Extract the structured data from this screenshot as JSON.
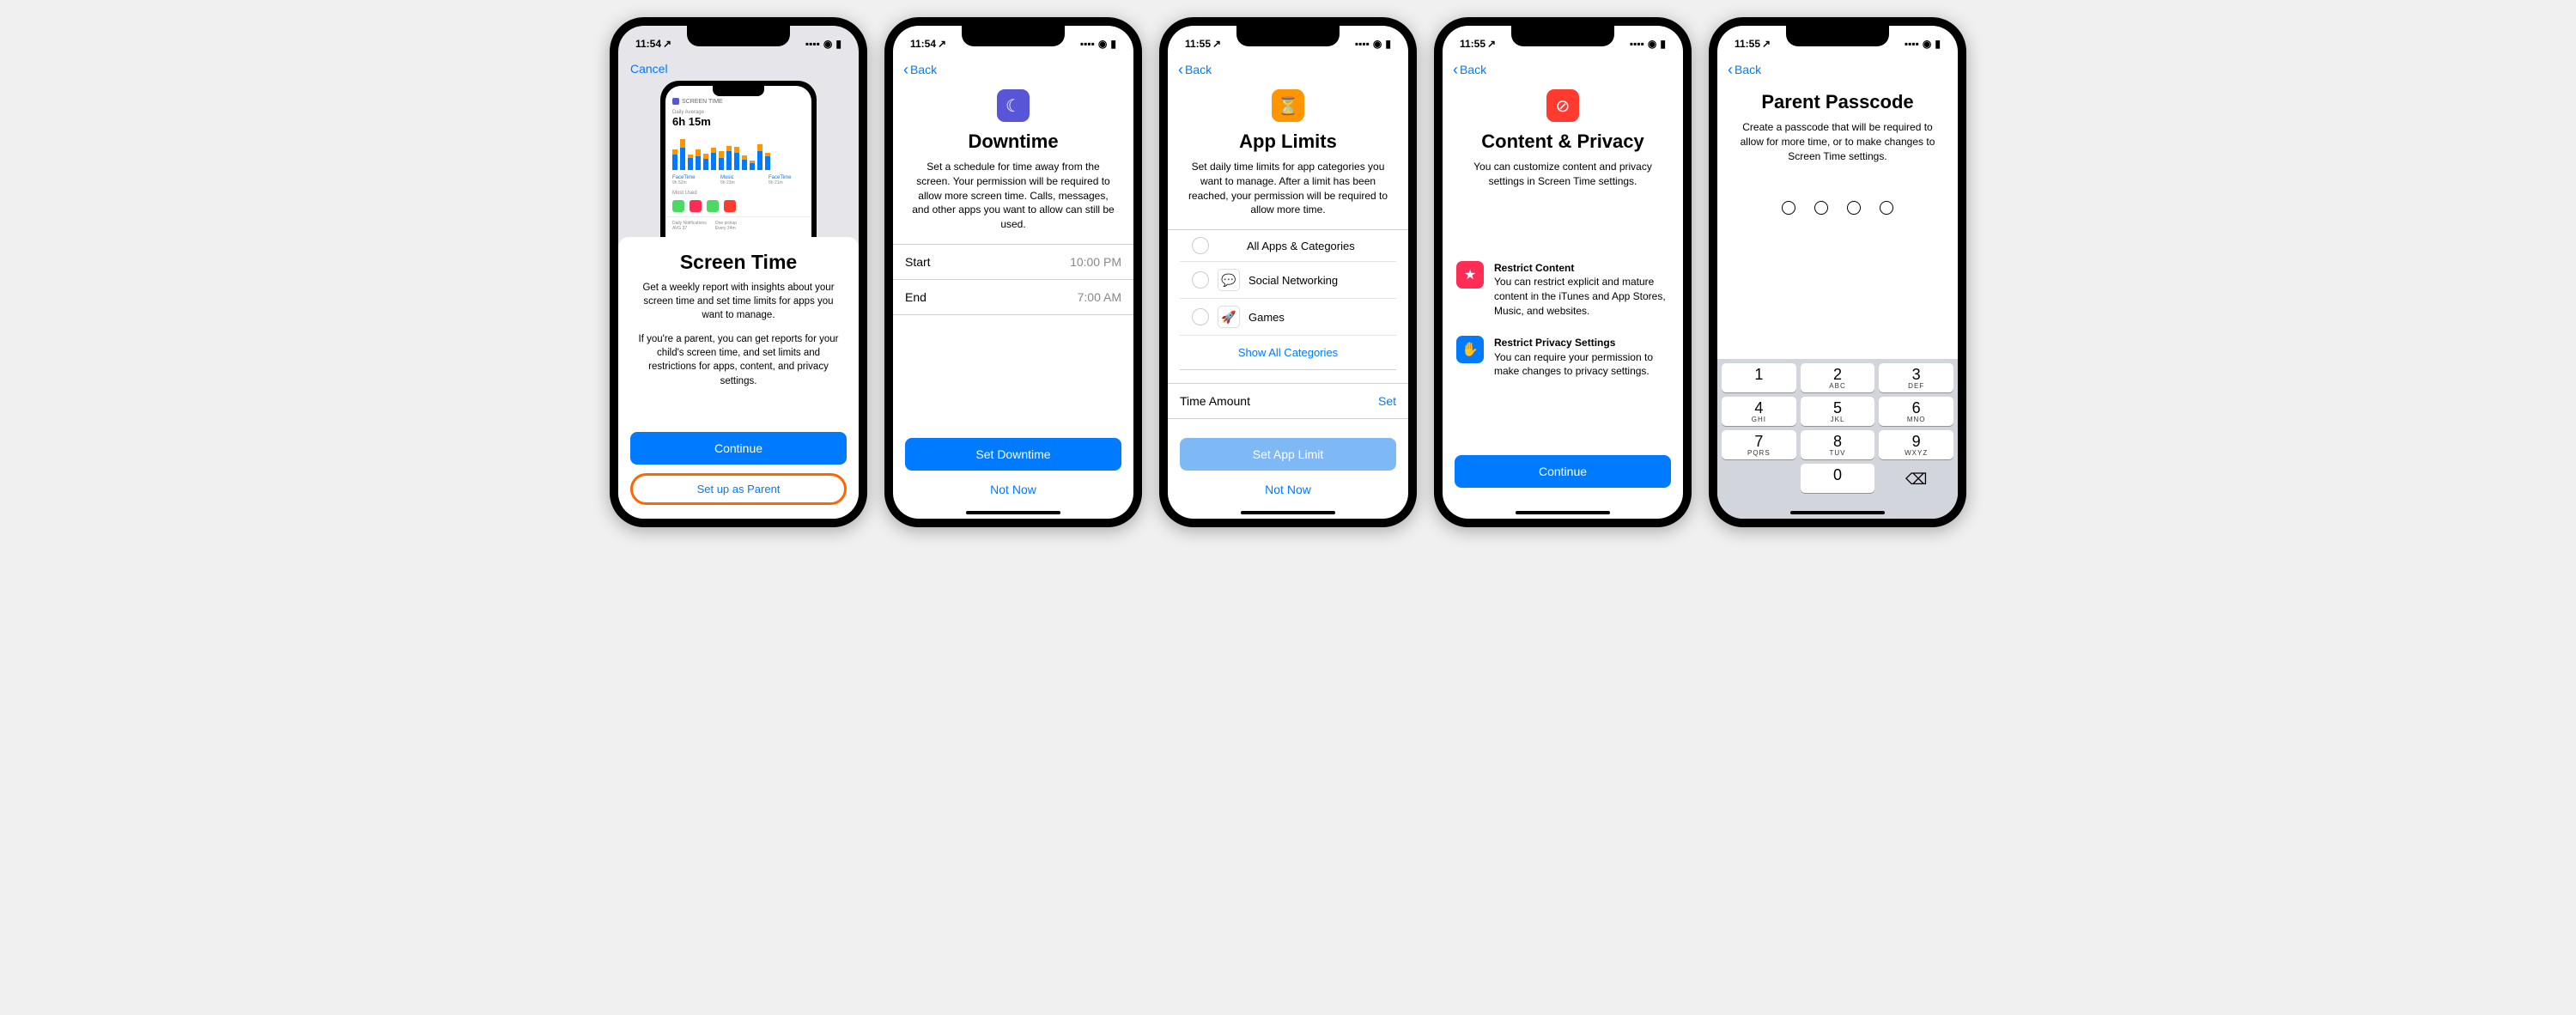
{
  "status": {
    "time1": "11:54",
    "time2": "11:55",
    "location_arrow": "↗"
  },
  "nav": {
    "cancel": "Cancel",
    "back": "Back"
  },
  "screen1": {
    "mini": {
      "header": "SCREEN TIME",
      "avg_label": "Daily Average",
      "avg_time": "6h 15m",
      "legend": [
        {
          "name": "FaceTime",
          "sub": "9h 52m"
        },
        {
          "name": "Music",
          "sub": "5h 23m"
        },
        {
          "name": "FaceTime",
          "sub": "5h 21m"
        }
      ],
      "most_used": "Most Used",
      "notif_label": "Daily Notifications",
      "notif_val": "AVG 37",
      "pickup_label": "One pickup",
      "pickup_val": "Every 34m"
    },
    "title": "Screen Time",
    "p1": "Get a weekly report with insights about your screen time and set time limits for apps you want to manage.",
    "p2": "If you're a parent, you can get reports for your child's screen time, and set limits and restrictions for apps, content, and privacy settings.",
    "continue": "Continue",
    "setup_parent": "Set up as Parent"
  },
  "screen2": {
    "title": "Downtime",
    "subtitle": "Set a schedule for time away from the screen. Your permission will be required to allow more screen time. Calls, messages, and other apps you want to allow can still be used.",
    "start_label": "Start",
    "start_value": "10:00 PM",
    "end_label": "End",
    "end_value": "7:00 AM",
    "set_btn": "Set Downtime",
    "not_now": "Not Now"
  },
  "screen3": {
    "title": "App Limits",
    "subtitle": "Set daily time limits for app categories you want to manage. After a limit has been reached, your permission will be required to allow more time.",
    "cat1": "All Apps & Categories",
    "cat2": "Social Networking",
    "cat3": "Games",
    "show_all": "Show All Categories",
    "time_amount": "Time Amount",
    "set": "Set",
    "set_btn": "Set App Limit",
    "not_now": "Not Now"
  },
  "screen4": {
    "title": "Content & Privacy",
    "subtitle": "You can customize content and privacy settings in Screen Time settings.",
    "f1_title": "Restrict Content",
    "f1_body": "You can restrict explicit and mature content in the iTunes and App Stores, Music, and websites.",
    "f2_title": "Restrict Privacy Settings",
    "f2_body": "You can require your permission to make changes to privacy settings.",
    "continue": "Continue"
  },
  "screen5": {
    "title": "Parent Passcode",
    "subtitle": "Create a passcode that will be required to allow for more time, or to make changes to Screen Time settings.",
    "keys": {
      "1": "",
      "2": "ABC",
      "3": "DEF",
      "4": "GHI",
      "5": "JKL",
      "6": "MNO",
      "7": "PQRS",
      "8": "TUV",
      "9": "WXYZ",
      "0": ""
    }
  }
}
